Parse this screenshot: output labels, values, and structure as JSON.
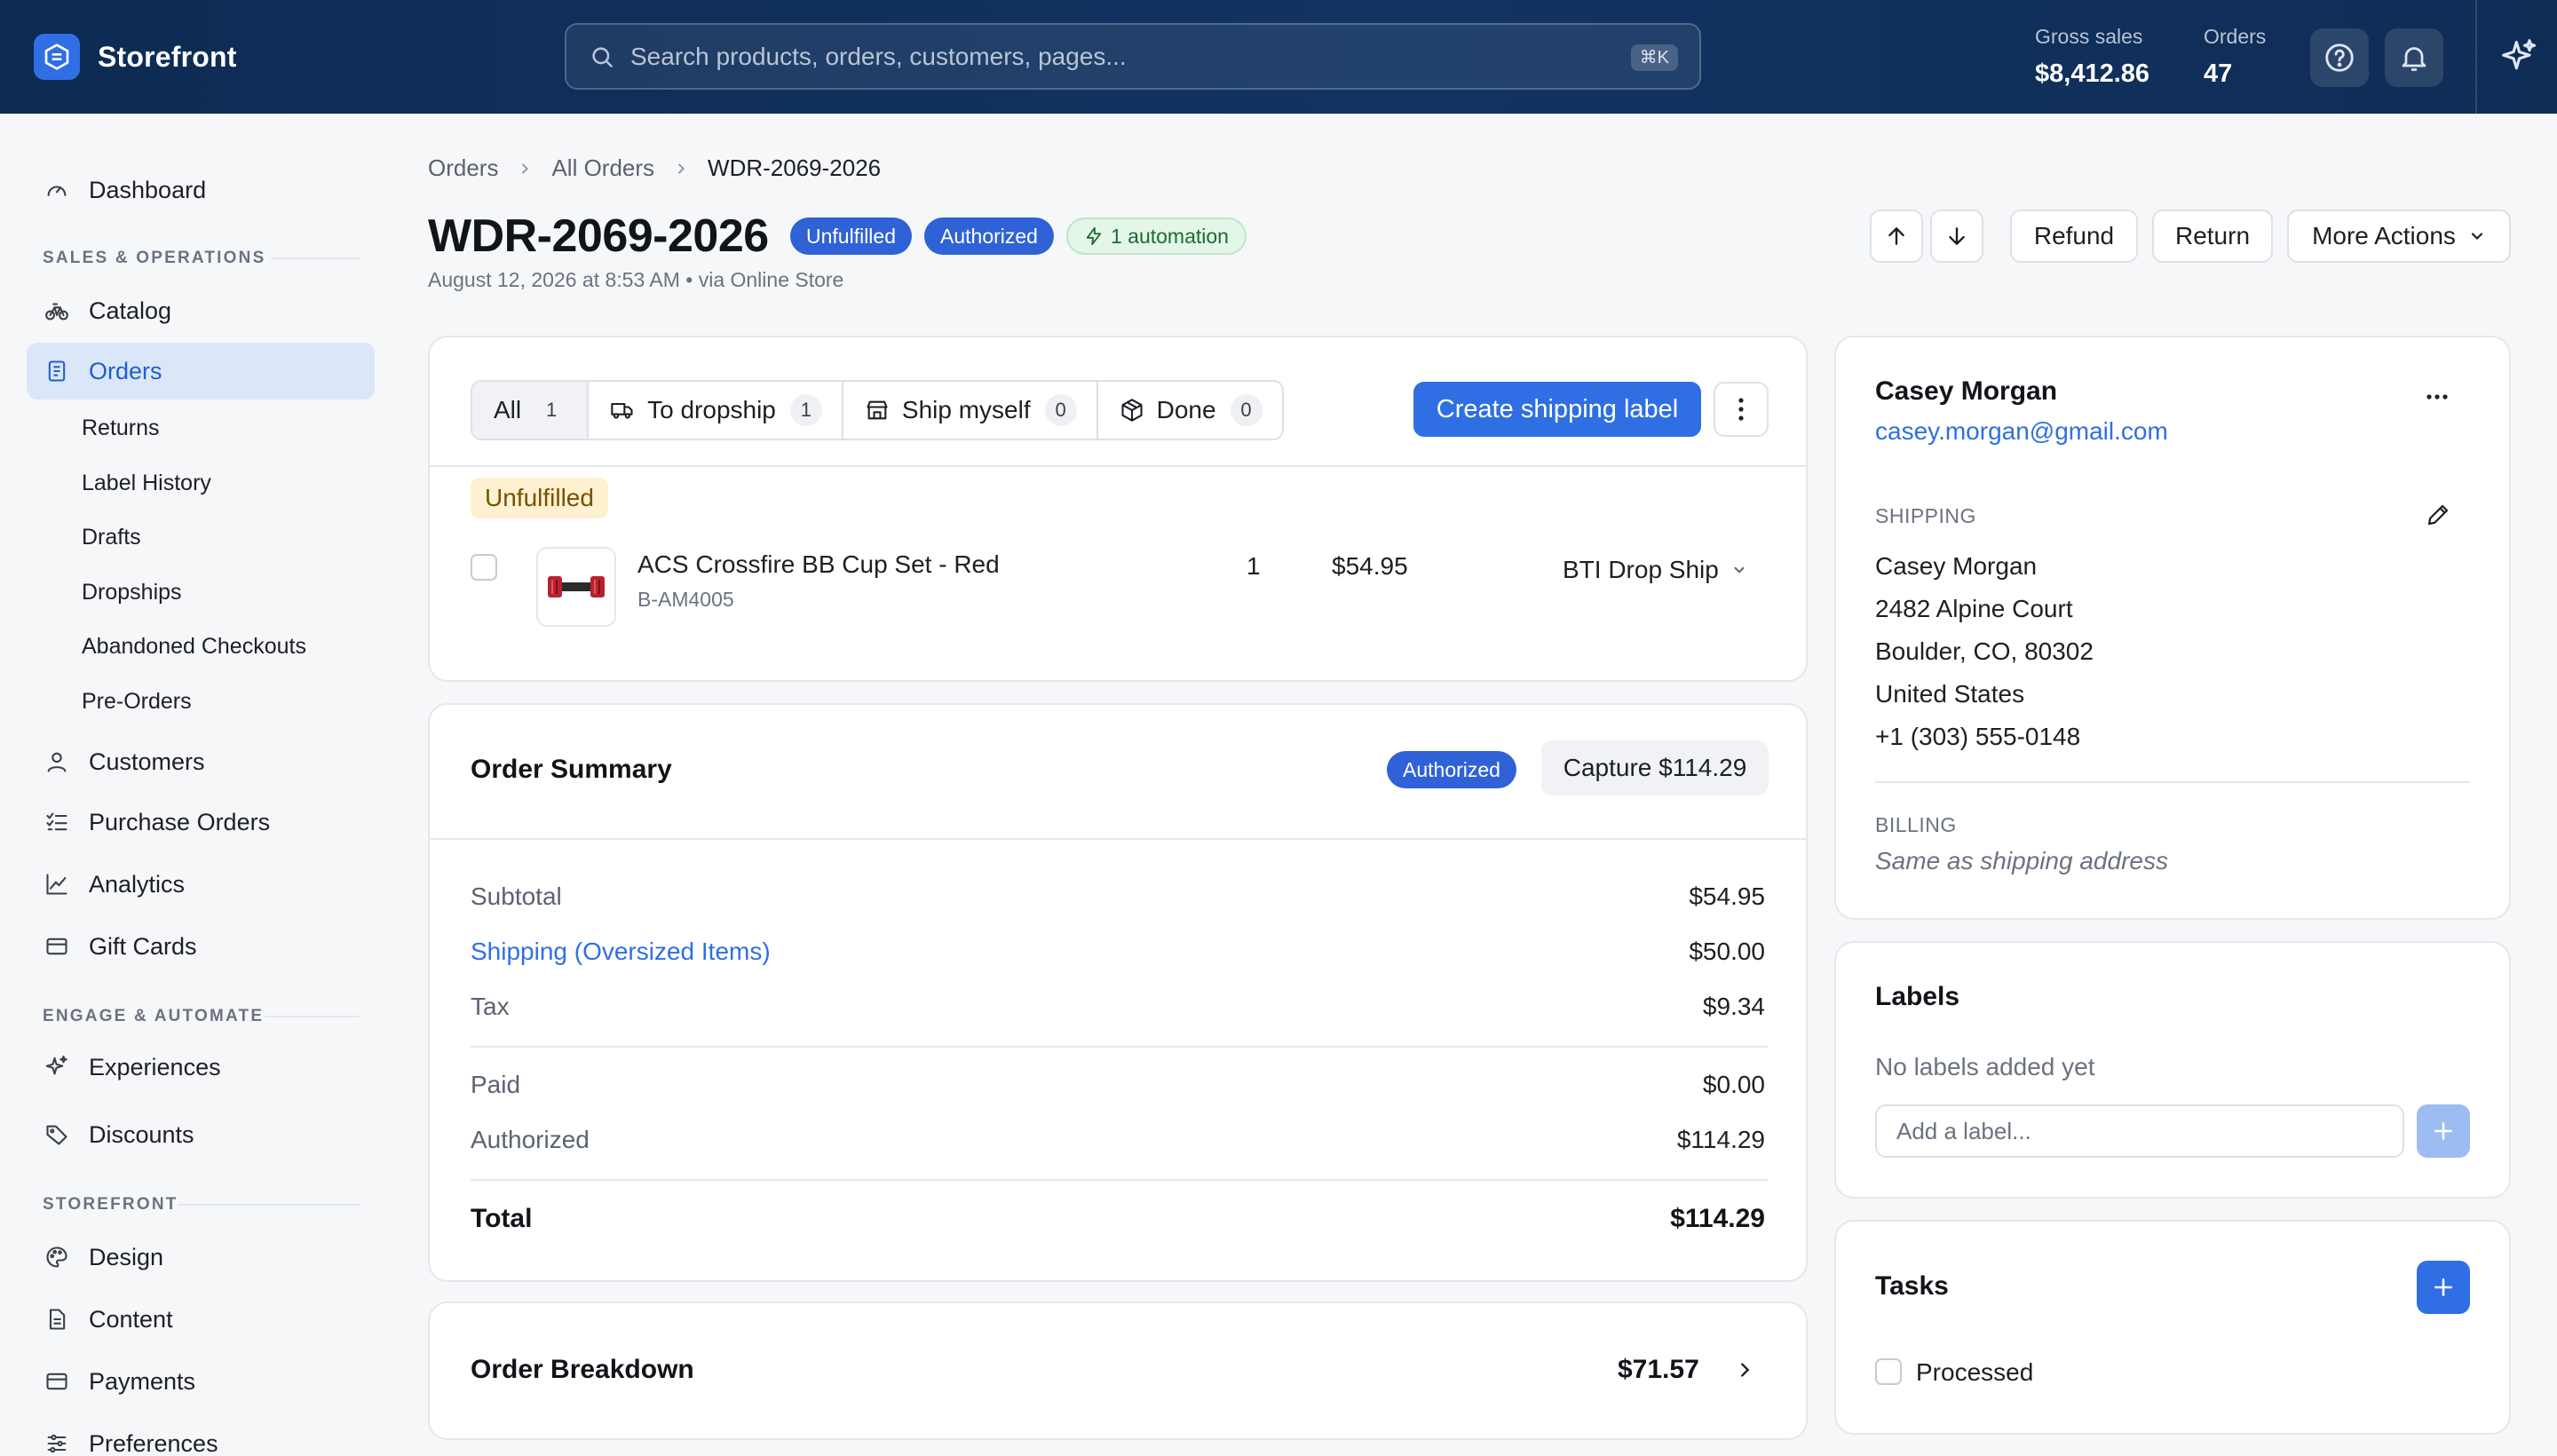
{
  "app": {
    "name": "Storefront",
    "search_placeholder": "Search products, orders, customers, pages...",
    "search_shortcut": "⌘K",
    "stats": [
      {
        "label": "Gross sales",
        "value": "$8,412.86"
      },
      {
        "label": "Orders",
        "value": "47"
      }
    ],
    "icons": {
      "logo": "storefront-logo-icon",
      "help": "help-circle-icon",
      "bell": "bell-icon",
      "sparkle": "sparkle-icon"
    }
  },
  "sidebar": {
    "top_item": {
      "label": "Dashboard",
      "icon": "gauge-icon"
    },
    "sections": [
      {
        "label": "SALES & OPERATIONS",
        "items": [
          {
            "label": "Catalog",
            "icon": "bicycle-icon"
          },
          {
            "label": "Orders",
            "icon": "receipt-icon",
            "active": true,
            "children": [
              "Returns",
              "Label History",
              "Drafts",
              "Dropships",
              "Abandoned Checkouts",
              "Pre-Orders"
            ]
          },
          {
            "label": "Customers",
            "icon": "user-icon"
          },
          {
            "label": "Purchase Orders",
            "icon": "checklist-icon"
          },
          {
            "label": "Analytics",
            "icon": "chart-line-icon"
          },
          {
            "label": "Gift Cards",
            "icon": "card-icon"
          }
        ]
      },
      {
        "label": "ENGAGE & AUTOMATE",
        "items": [
          {
            "label": "Experiences",
            "icon": "sparkle-icon"
          },
          {
            "label": "Discounts",
            "icon": "tag-icon"
          }
        ]
      },
      {
        "label": "STOREFRONT",
        "items": [
          {
            "label": "Design",
            "icon": "palette-icon"
          },
          {
            "label": "Content",
            "icon": "document-icon"
          },
          {
            "label": "Payments",
            "icon": "credit-card-icon"
          },
          {
            "label": "Preferences",
            "icon": "sliders-icon"
          }
        ]
      }
    ]
  },
  "breadcrumb": [
    "Orders",
    "All Orders",
    "WDR-2069-2026"
  ],
  "order": {
    "id": "WDR-2069-2026",
    "badges": [
      "Unfulfilled",
      "Authorized"
    ],
    "automation_badge": "1 automation",
    "subtitle": "August 12, 2026 at 8:53 AM • via Online Store"
  },
  "header_actions": {
    "prev_icon": "arrow-up-icon",
    "next_icon": "arrow-down-icon",
    "refund": "Refund",
    "return": "Return",
    "more": "More Actions"
  },
  "fulfillment": {
    "tabs": [
      {
        "label": "All",
        "count": "1",
        "icon": ""
      },
      {
        "label": "To dropship",
        "count": "1",
        "icon": "truck-icon"
      },
      {
        "label": "Ship myself",
        "count": "0",
        "icon": "store-icon"
      },
      {
        "label": "Done",
        "count": "0",
        "icon": "box-icon"
      }
    ],
    "create_label": "Create shipping label",
    "status": "Unfulfilled",
    "line_item": {
      "name": "ACS Crossfire BB Cup Set - Red",
      "sku": "B-AM4005",
      "qty": "1",
      "price": "$54.95",
      "vendor": "BTI Drop Ship"
    }
  },
  "summary": {
    "title": "Order Summary",
    "badge": "Authorized",
    "capture": "Capture $114.29",
    "rows": [
      {
        "label": "Subtotal",
        "value": "$54.95"
      },
      {
        "label": "Shipping (Oversized Items)",
        "value": "$50.00",
        "link": true
      },
      {
        "label": "Tax",
        "value": "$9.34"
      },
      {
        "label": "Paid",
        "value": "$0.00"
      },
      {
        "label": "Authorized",
        "value": "$114.29"
      }
    ],
    "total_label": "Total",
    "total_value": "$114.29"
  },
  "breakdown": {
    "title": "Order Breakdown",
    "value": "$71.57"
  },
  "customer": {
    "name": "Casey Morgan",
    "email": "casey.morgan@gmail.com",
    "shipping_label": "SHIPPING",
    "shipping_lines": [
      "Casey Morgan",
      "2482 Alpine Court",
      "Boulder, CO, 80302",
      "United States",
      "+1 (303) 555-0148"
    ],
    "billing_label": "BILLING",
    "billing_note": "Same as shipping address"
  },
  "labels": {
    "title": "Labels",
    "empty": "No labels added yet",
    "placeholder": "Add a label..."
  },
  "tasks": {
    "title": "Tasks",
    "items": [
      "Processed"
    ]
  },
  "colors": {
    "accent": "#2f6fe3",
    "topbar": "#0d2a52",
    "active_nav_bg": "#dbe6f8",
    "warning_bg": "#fdf1cf",
    "success_bg": "#e4f6e8"
  }
}
